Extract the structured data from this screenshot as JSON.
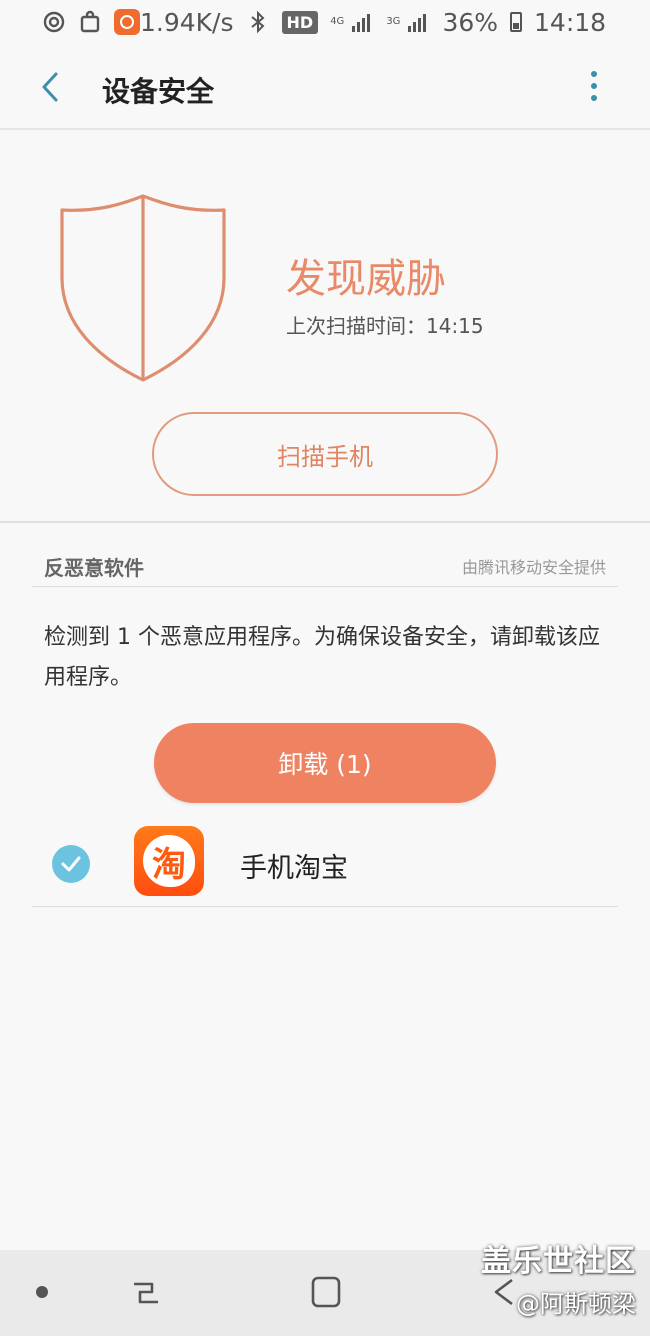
{
  "status_bar": {
    "network_speed": "1.94K/s",
    "hd_label": "HD",
    "net1": "4G",
    "net2": "3G",
    "battery": "36%",
    "time": "14:18"
  },
  "header": {
    "title": "设备安全"
  },
  "threat": {
    "title": "发现威胁",
    "last_scan": "上次扫描时间：14:15",
    "scan_button": "扫描手机",
    "color": "#e88a68"
  },
  "antimalware": {
    "section_title": "反恶意软件",
    "provider": "由腾讯移动安全提供",
    "description": "检测到 1 个恶意应用程序。为确保设备安全，请卸载该应用程序。",
    "uninstall_button": "卸载 (1)",
    "apps": [
      {
        "name": "手机淘宝",
        "icon_char": "淘",
        "selected": true
      }
    ]
  },
  "watermark": {
    "line1": "盖乐世社区",
    "line2": "@阿斯顿梁"
  }
}
